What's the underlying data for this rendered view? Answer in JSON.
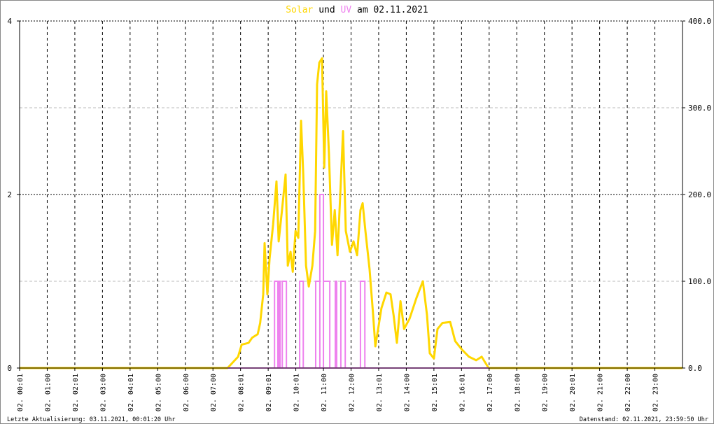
{
  "chart_data": {
    "type": "line",
    "title": {
      "part1": "Solar",
      "part2": " und ",
      "part3": "UV",
      "part4": " am 02.11.2021"
    },
    "colors": {
      "solar": "#ffd700",
      "uv": "#ee82ee",
      "grid": "#000000",
      "subgrid": "#bbbbbb"
    },
    "left_axis": {
      "range": [
        0,
        4
      ],
      "ticks": [
        "0",
        "2",
        "4"
      ]
    },
    "right_axis": {
      "range": [
        0,
        400
      ],
      "ticks": [
        "0.0",
        "100.0",
        "200.0",
        "300.0",
        "400.0"
      ]
    },
    "x_range_hours": [
      0,
      24
    ],
    "x_tick_labels": [
      "02. 00:01",
      "02. 01:00",
      "02. 02:01",
      "02. 03:00",
      "02. 04:01",
      "02. 05:00",
      "02. 06:00",
      "02. 07:00",
      "02. 08:01",
      "02. 09:01",
      "02. 10:01",
      "02. 11:00",
      "02. 12:00",
      "02. 13:01",
      "02. 14:00",
      "02. 15:01",
      "02. 16:01",
      "02. 17:00",
      "02. 18:00",
      "02. 19:00",
      "02. 20:01",
      "02. 21:00",
      "02. 22:00",
      "02. 23:00"
    ],
    "series": [
      {
        "name": "Solar",
        "axis": "right",
        "points": [
          [
            0,
            0
          ],
          [
            7.53,
            0
          ],
          [
            7.91,
            13
          ],
          [
            8.04,
            27
          ],
          [
            8.29,
            29
          ],
          [
            8.42,
            35
          ],
          [
            8.62,
            39
          ],
          [
            8.71,
            52
          ],
          [
            8.82,
            85
          ],
          [
            8.87,
            144
          ],
          [
            8.97,
            85
          ],
          [
            9.05,
            126
          ],
          [
            9.18,
            166
          ],
          [
            9.3,
            215
          ],
          [
            9.38,
            146
          ],
          [
            9.5,
            182
          ],
          [
            9.63,
            223
          ],
          [
            9.71,
            118
          ],
          [
            9.81,
            134
          ],
          [
            9.89,
            111
          ],
          [
            9.99,
            158
          ],
          [
            10.09,
            150
          ],
          [
            10.19,
            285
          ],
          [
            10.27,
            223
          ],
          [
            10.37,
            118
          ],
          [
            10.47,
            94
          ],
          [
            10.6,
            118
          ],
          [
            10.7,
            158
          ],
          [
            10.77,
            327
          ],
          [
            10.85,
            352
          ],
          [
            10.95,
            357
          ],
          [
            11.03,
            231
          ],
          [
            11.1,
            319
          ],
          [
            11.2,
            247
          ],
          [
            11.31,
            142
          ],
          [
            11.41,
            182
          ],
          [
            11.51,
            130
          ],
          [
            11.63,
            215
          ],
          [
            11.71,
            273
          ],
          [
            11.81,
            158
          ],
          [
            11.96,
            134
          ],
          [
            12.09,
            146
          ],
          [
            12.22,
            130
          ],
          [
            12.34,
            182
          ],
          [
            12.42,
            190
          ],
          [
            12.52,
            158
          ],
          [
            12.67,
            114
          ],
          [
            12.8,
            61
          ],
          [
            12.88,
            25
          ],
          [
            12.98,
            45
          ],
          [
            13.1,
            69
          ],
          [
            13.28,
            87
          ],
          [
            13.43,
            85
          ],
          [
            13.54,
            61
          ],
          [
            13.66,
            29
          ],
          [
            13.79,
            77
          ],
          [
            13.92,
            45
          ],
          [
            14.12,
            57
          ],
          [
            14.37,
            81
          ],
          [
            14.6,
            100
          ],
          [
            14.75,
            61
          ],
          [
            14.85,
            17
          ],
          [
            15.0,
            11
          ],
          [
            15.13,
            45
          ],
          [
            15.31,
            52
          ],
          [
            15.59,
            53
          ],
          [
            15.77,
            31
          ],
          [
            16.02,
            21
          ],
          [
            16.27,
            13
          ],
          [
            16.53,
            9
          ],
          [
            16.73,
            13
          ],
          [
            16.98,
            0
          ],
          [
            24,
            0
          ]
        ]
      },
      {
        "name": "UV",
        "axis": "left",
        "intervals": [
          [
            9.23,
            9.35,
            1
          ],
          [
            9.4,
            9.43,
            1
          ],
          [
            9.51,
            9.66,
            1
          ],
          [
            10.14,
            10.27,
            1
          ],
          [
            10.72,
            10.87,
            1
          ],
          [
            10.87,
            11.0,
            2
          ],
          [
            11.0,
            11.23,
            1
          ],
          [
            11.43,
            11.48,
            1
          ],
          [
            11.63,
            11.79,
            1
          ],
          [
            12.34,
            12.5,
            1
          ]
        ]
      }
    ]
  },
  "footer": {
    "last_update": "Letzte Aktualisierung: 03.11.2021, 00:01:20 Uhr",
    "data_state": "Datenstand: 02.11.2021, 23:59:50 Uhr"
  }
}
